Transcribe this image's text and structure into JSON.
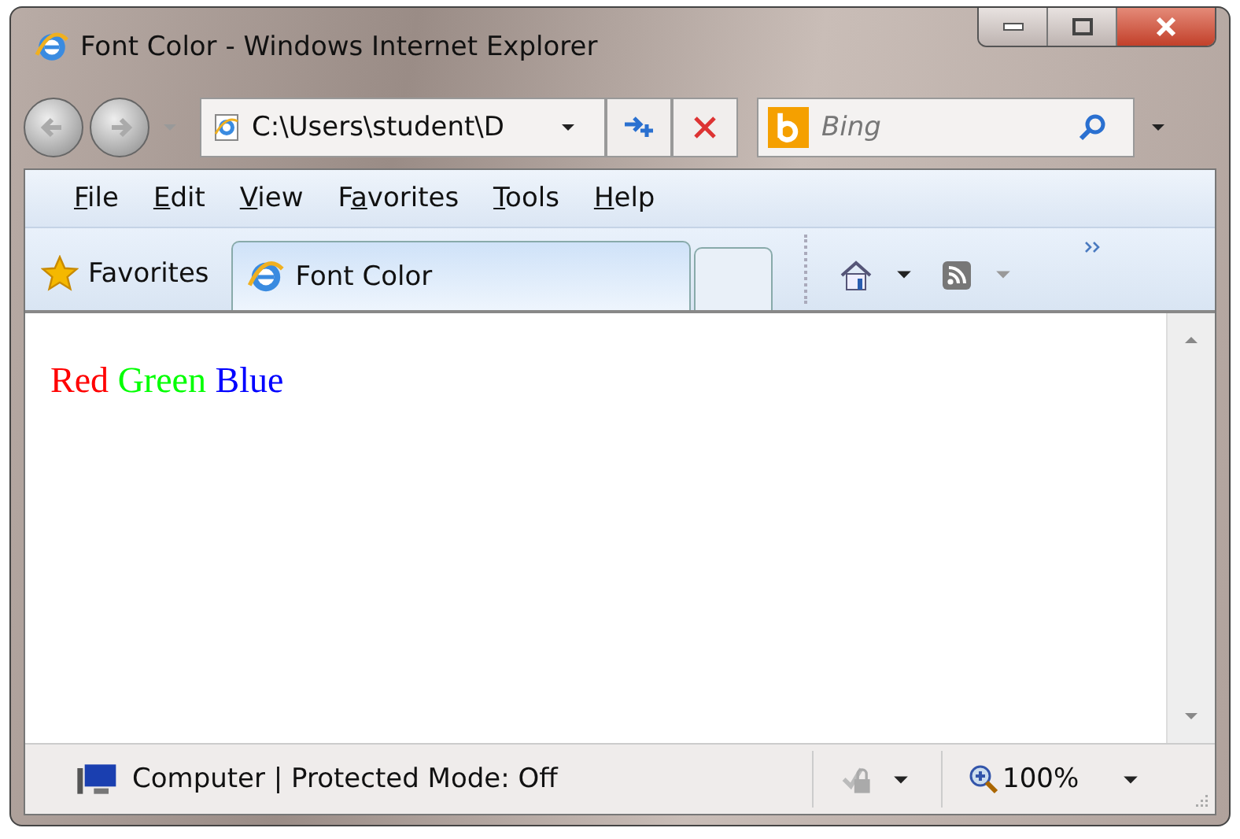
{
  "window": {
    "title": "Font Color - Windows Internet Explorer"
  },
  "address_bar": {
    "value": "C:\\Users\\student\\D"
  },
  "search": {
    "placeholder": "Bing"
  },
  "menu": [
    {
      "access_key": "F",
      "after": "ile"
    },
    {
      "access_key": "E",
      "after": "dit"
    },
    {
      "access_key": "V",
      "after": "iew"
    },
    {
      "before": "F",
      "access_key": "a",
      "after": "vorites"
    },
    {
      "access_key": "T",
      "after": "ools"
    },
    {
      "access_key": "H",
      "after": "elp"
    }
  ],
  "favorites_button": {
    "label": "Favorites"
  },
  "tabs": [
    {
      "label": "Font Color",
      "selected": true
    }
  ],
  "content": {
    "words": [
      {
        "text": "Red",
        "color": "#ff0000"
      },
      {
        "text": "Green",
        "color": "#00ff00"
      },
      {
        "text": "Blue",
        "color": "#0000ff"
      }
    ]
  },
  "status_bar": {
    "zone": "Computer | Protected Mode: Off",
    "zoom": "100%"
  }
}
